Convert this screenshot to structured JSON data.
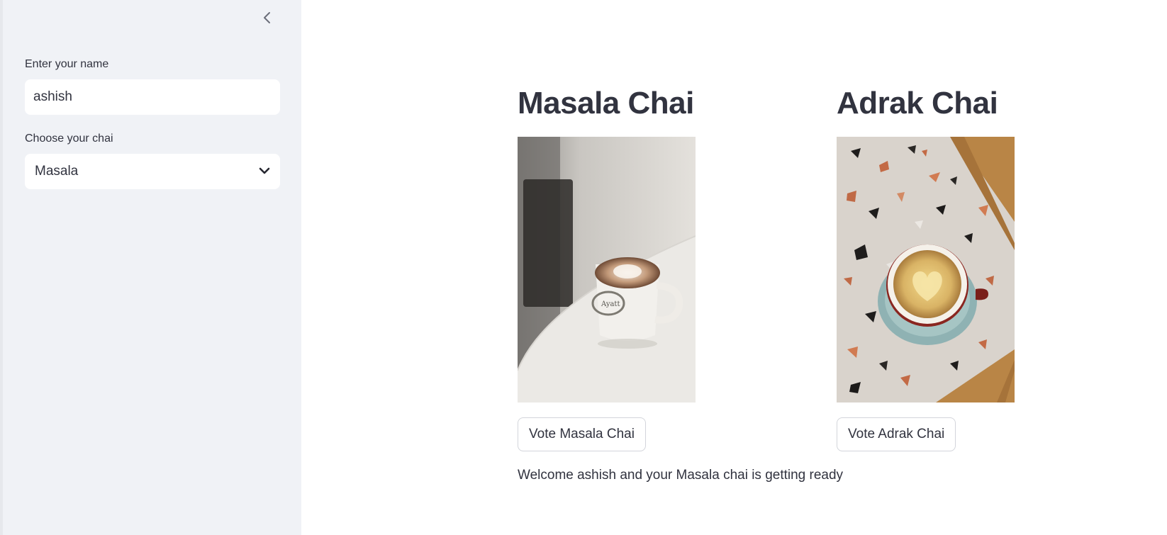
{
  "sidebar": {
    "collapse_icon": "chevron-left-icon",
    "name_field": {
      "label": "Enter your name",
      "value": "ashish"
    },
    "chai_select": {
      "label": "Choose your chai",
      "selected": "Masala",
      "icon": "chevron-down-icon"
    }
  },
  "main": {
    "columns": [
      {
        "title": "Masala Chai",
        "image": "latte-art-mug-on-table-photo",
        "button_label": "Vote Masala Chai"
      },
      {
        "title": "Adrak Chai",
        "image": "heart-latte-cup-on-terrazzo-photo",
        "button_label": "Vote Adrak Chai"
      }
    ],
    "welcome_message": "Welcome ashish and your Masala chai is getting ready"
  },
  "colors": {
    "sidebar_bg": "#f0f2f6",
    "text": "#31333f",
    "button_border": "#d3d5db"
  }
}
